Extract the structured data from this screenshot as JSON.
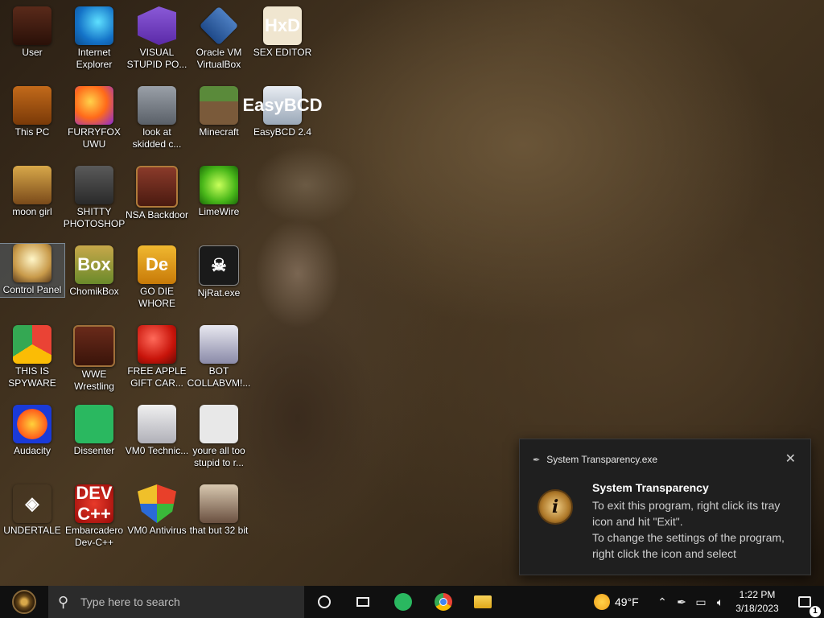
{
  "desktop": {
    "icons": [
      {
        "label": "User",
        "icon": "user-folder-icon"
      },
      {
        "label": "Internet Explorer",
        "icon": "edge-icon"
      },
      {
        "label": "VISUAL STUPID PO...",
        "icon": "visual-studio-icon"
      },
      {
        "label": "Oracle VM VirtualBox",
        "icon": "virtualbox-icon"
      },
      {
        "label": "SEX EDITOR",
        "icon": "hxd-icon",
        "glyph": "HxD"
      },
      {
        "label": "This PC",
        "icon": "computer-icon"
      },
      {
        "label": "FURRYFOX UWU",
        "icon": "firefox-icon"
      },
      {
        "label": "look at skidded c...",
        "icon": "stacked-windows-icon"
      },
      {
        "label": "Minecraft",
        "icon": "minecraft-icon"
      },
      {
        "label": "EasyBCD 2.4",
        "icon": "easybcd-icon",
        "glyph": "EasyBCD"
      },
      {
        "label": "moon girl",
        "icon": "folder-icon"
      },
      {
        "label": "SHITTY PHOTOSHOP",
        "icon": "gimp-icon"
      },
      {
        "label": "NSA Backdoor",
        "icon": "framed-folder-icon"
      },
      {
        "label": "LimeWire",
        "icon": "limewire-icon"
      },
      {
        "label": "Control Panel",
        "icon": "control-panel-icon"
      },
      {
        "label": "ChomikBox",
        "icon": "chomikbox-icon",
        "glyph": "Box"
      },
      {
        "label": "GO DIE WHORE",
        "icon": "de-icon",
        "glyph": "De"
      },
      {
        "label": "NjRat.exe",
        "icon": "skull-icon",
        "glyph": "☠"
      },
      {
        "label": "THIS IS SPYWARE",
        "icon": "chrome-icon"
      },
      {
        "label": "WWE Wrestling",
        "icon": "framed-folder-icon"
      },
      {
        "label": "FREE APPLE GIFT CAR...",
        "icon": "apple-icon"
      },
      {
        "label": "BOT COLLABVM!...",
        "icon": "monitor-icon"
      },
      {
        "label": "Audacity",
        "icon": "audacity-icon"
      },
      {
        "label": "Dissenter",
        "icon": "dissenter-icon"
      },
      {
        "label": "VM0 Technic...",
        "icon": "technician-icon"
      },
      {
        "label": "youre all too stupid to r...",
        "icon": "portrait-icon"
      },
      {
        "label": "UNDERTALE",
        "icon": "unity-icon",
        "glyph": "◈"
      },
      {
        "label": "Embarcadero Dev-C++",
        "icon": "devcpp-icon",
        "glyph": "DEV C++"
      },
      {
        "label": "VM0 Antivirus",
        "icon": "shield-icon"
      },
      {
        "label": "that but 32 bit",
        "icon": "portrait-icon"
      }
    ]
  },
  "notification": {
    "app_name": "System Transparency.exe",
    "close_glyph": "✕",
    "info_glyph": "i",
    "title": "System Transparency",
    "body_line1": "To exit this program, right click its tray icon and hit \"Exit\".",
    "body_line2": "To change the settings of the program, right click the icon and select"
  },
  "taskbar": {
    "search_placeholder": "Type here to search",
    "weather_temp": "49°F",
    "time": "1:22 PM",
    "date": "3/18/2023",
    "notification_count": "1"
  }
}
